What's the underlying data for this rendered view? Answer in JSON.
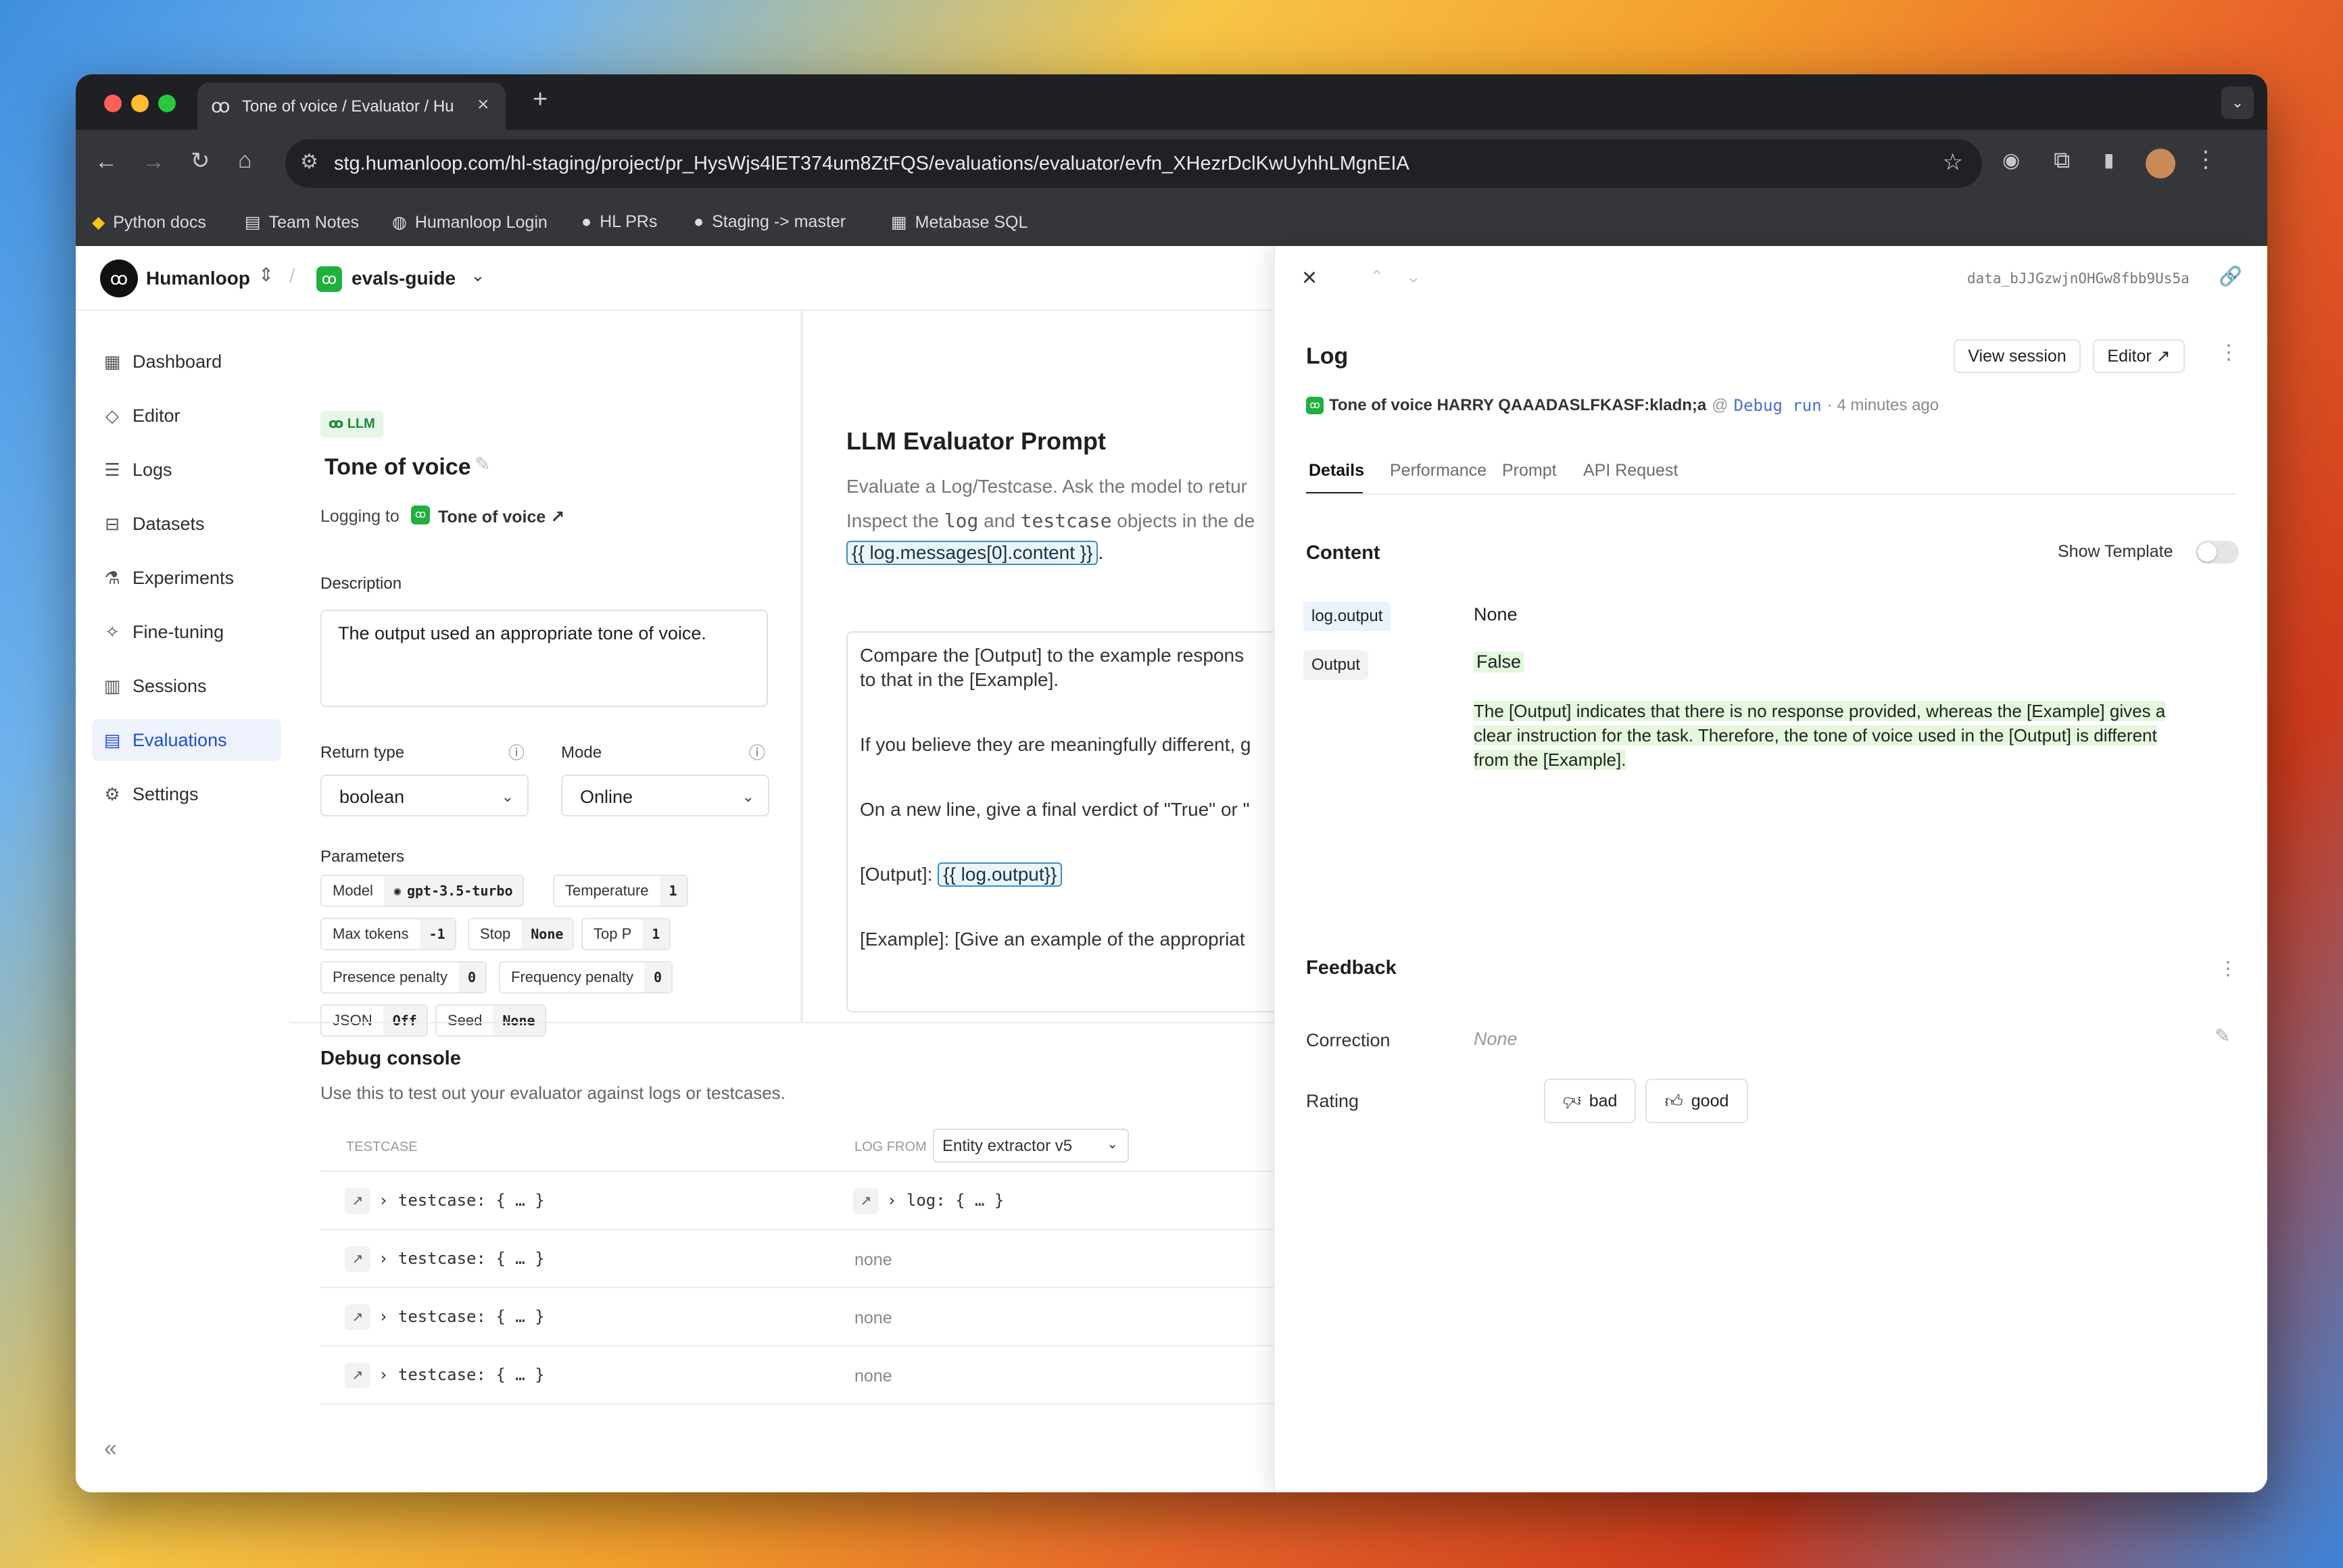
{
  "browser": {
    "tab_title": "Tone of voice / Evaluator / Hu",
    "url": "stg.humanloop.com/hl-staging/project/pr_HysWjs4lET374um8ZtFQS/evaluations/evaluator/evfn_XHezrDclKwUyhhLMgnEIA",
    "bookmarks": [
      "Python docs",
      "Team Notes",
      "Humanloop Login",
      "HL PRs",
      "Staging -> master",
      "Metabase SQL"
    ]
  },
  "header": {
    "brand": "Humanloop",
    "project": "evals-guide"
  },
  "sidebar": {
    "items": [
      {
        "label": "Dashboard",
        "icon": "grid-icon"
      },
      {
        "label": "Editor",
        "icon": "editor-icon"
      },
      {
        "label": "Logs",
        "icon": "database-icon"
      },
      {
        "label": "Datasets",
        "icon": "datasets-icon"
      },
      {
        "label": "Experiments",
        "icon": "flask-icon"
      },
      {
        "label": "Fine-tuning",
        "icon": "sparkle-icon"
      },
      {
        "label": "Sessions",
        "icon": "columns-icon"
      },
      {
        "label": "Evaluations",
        "icon": "clipboard-icon",
        "active": true
      },
      {
        "label": "Settings",
        "icon": "gear-icon"
      }
    ],
    "collapse_icon": "«"
  },
  "evaluator": {
    "badge": "LLM",
    "title": "Tone of voice",
    "logging_prefix": "Logging to",
    "logging_target": "Tone of voice ↗",
    "description_label": "Description",
    "description": "The output used an appropriate tone of voice.",
    "return_type_label": "Return type",
    "return_type": "boolean",
    "mode_label": "Mode",
    "mode": "Online",
    "parameters_label": "Parameters",
    "params": {
      "model_k": "Model",
      "model_v": "gpt-3.5-turbo",
      "temperature_k": "Temperature",
      "temperature_v": "1",
      "max_tokens_k": "Max tokens",
      "max_tokens_v": "-1",
      "stop_k": "Stop",
      "stop_v": "None",
      "top_p_k": "Top P",
      "top_p_v": "1",
      "presence_k": "Presence penalty",
      "presence_v": "0",
      "frequency_k": "Frequency penalty",
      "frequency_v": "0",
      "json_k": "JSON",
      "json_v": "Off",
      "seed_k": "Seed",
      "seed_v": "None"
    }
  },
  "prompt": {
    "title": "LLM Evaluator Prompt",
    "desc1": "Evaluate a Log/Testcase. Ask the model to retur",
    "desc2_a": "Inspect the",
    "desc2_code1": "log",
    "desc2_b": "and",
    "desc2_code2": "testcase",
    "desc2_c": "objects in the de",
    "var_example": "{{ log.messages[0].content }}",
    "line1": "Compare the [Output] to the example respons",
    "line2": "to that in the [Example].",
    "line3": "If you believe they are meaningfully different, g",
    "line4": "On a new line, give a final verdict of \"True\" or \"",
    "line5_label": "[Output]:",
    "line5_var": "{{ log.output}}",
    "line6": "[Example]: [Give an example of the appropriat"
  },
  "debug": {
    "title": "Debug console",
    "subtitle": "Use this to test out your evaluator against logs or testcases.",
    "col_testcase": "TESTCASE",
    "col_logfrom": "LOG FROM",
    "log_from_value": "Entity extractor v5",
    "rows": [
      {
        "testcase": "testcase: { … }",
        "log": "log: { … }"
      },
      {
        "testcase": "testcase: { … }",
        "log": "none"
      },
      {
        "testcase": "testcase: { … }",
        "log": "none"
      },
      {
        "testcase": "testcase: { … }",
        "log": "none"
      }
    ]
  },
  "panel": {
    "data_id": "data_bJJGzwjnOHGw8fbb9Us5a",
    "title": "Log",
    "view_session": "View session",
    "editor": "Editor ↗",
    "meta_name": "Tone of voice HARRY QAAADASLFKASF:kladn;a",
    "meta_at": "@",
    "meta_link": "Debug run",
    "meta_time": "· 4 minutes ago",
    "tabs": [
      "Details",
      "Performance",
      "Prompt",
      "API Request"
    ],
    "content_title": "Content",
    "show_template": "Show Template",
    "log_output_key": "log.output",
    "log_output_val": "None",
    "output_key": "Output",
    "output_val": "False",
    "output_text": "The [Output] indicates that there is no response provided, whereas the [Example] gives a clear instruction for the task. Therefore, the tone of voice used in the [Output] is different from the [Example].",
    "feedback_title": "Feedback",
    "correction_label": "Correction",
    "correction_val": "None",
    "rating_label": "Rating",
    "bad": "bad",
    "good": "good"
  }
}
